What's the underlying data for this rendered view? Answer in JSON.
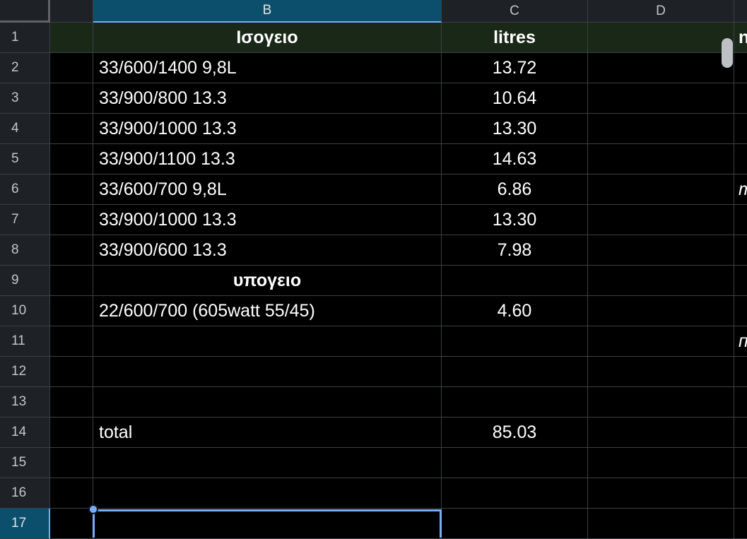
{
  "columns": {
    "a": "",
    "b": "B",
    "c": "C",
    "d": "D"
  },
  "rows": [
    {
      "num": "1",
      "b": "Ισογειο",
      "c": "litres",
      "e": "n"
    },
    {
      "num": "2",
      "b": "33/600/1400 9,8L",
      "c": "13.72",
      "e": ""
    },
    {
      "num": "3",
      "b": "33/900/800 13.3",
      "c": "10.64",
      "e": ""
    },
    {
      "num": "4",
      "b": "33/900/1000 13.3",
      "c": "13.30",
      "e": ""
    },
    {
      "num": "5",
      "b": "33/900/1100 13.3",
      "c": "14.63",
      "e": ""
    },
    {
      "num": "6",
      "b": "33/600/700 9,8L",
      "c": "6.86",
      "e": "т"
    },
    {
      "num": "7",
      "b": "33/900/1000 13.3",
      "c": "13.30",
      "e": ""
    },
    {
      "num": "8",
      "b": "33/900/600 13.3",
      "c": "7.98",
      "e": ""
    },
    {
      "num": "9",
      "b": "υπογειο",
      "c": "",
      "e": ""
    },
    {
      "num": "10",
      "b": "22/600/700 (605watt 55/45)",
      "c": "4.60",
      "e": ""
    },
    {
      "num": "11",
      "b": "",
      "c": "",
      "e": "п"
    },
    {
      "num": "12",
      "b": "",
      "c": "",
      "e": ""
    },
    {
      "num": "13",
      "b": "",
      "c": "",
      "e": ""
    },
    {
      "num": "14",
      "b": "total",
      "c": "85.03",
      "e": ""
    },
    {
      "num": "15",
      "b": "",
      "c": "",
      "e": ""
    },
    {
      "num": "16",
      "b": "",
      "c": "",
      "e": ""
    },
    {
      "num": "17",
      "b": "",
      "c": "",
      "e": ""
    }
  ],
  "colors": {
    "background": "#000000",
    "header_bg": "#1e2125",
    "selected_header_bg": "#0b4f6c",
    "row1_fill": "#1a2818",
    "selection_border": "#7cacf8",
    "gridline": "#3c4043"
  },
  "selection": {
    "cell": "B17"
  }
}
